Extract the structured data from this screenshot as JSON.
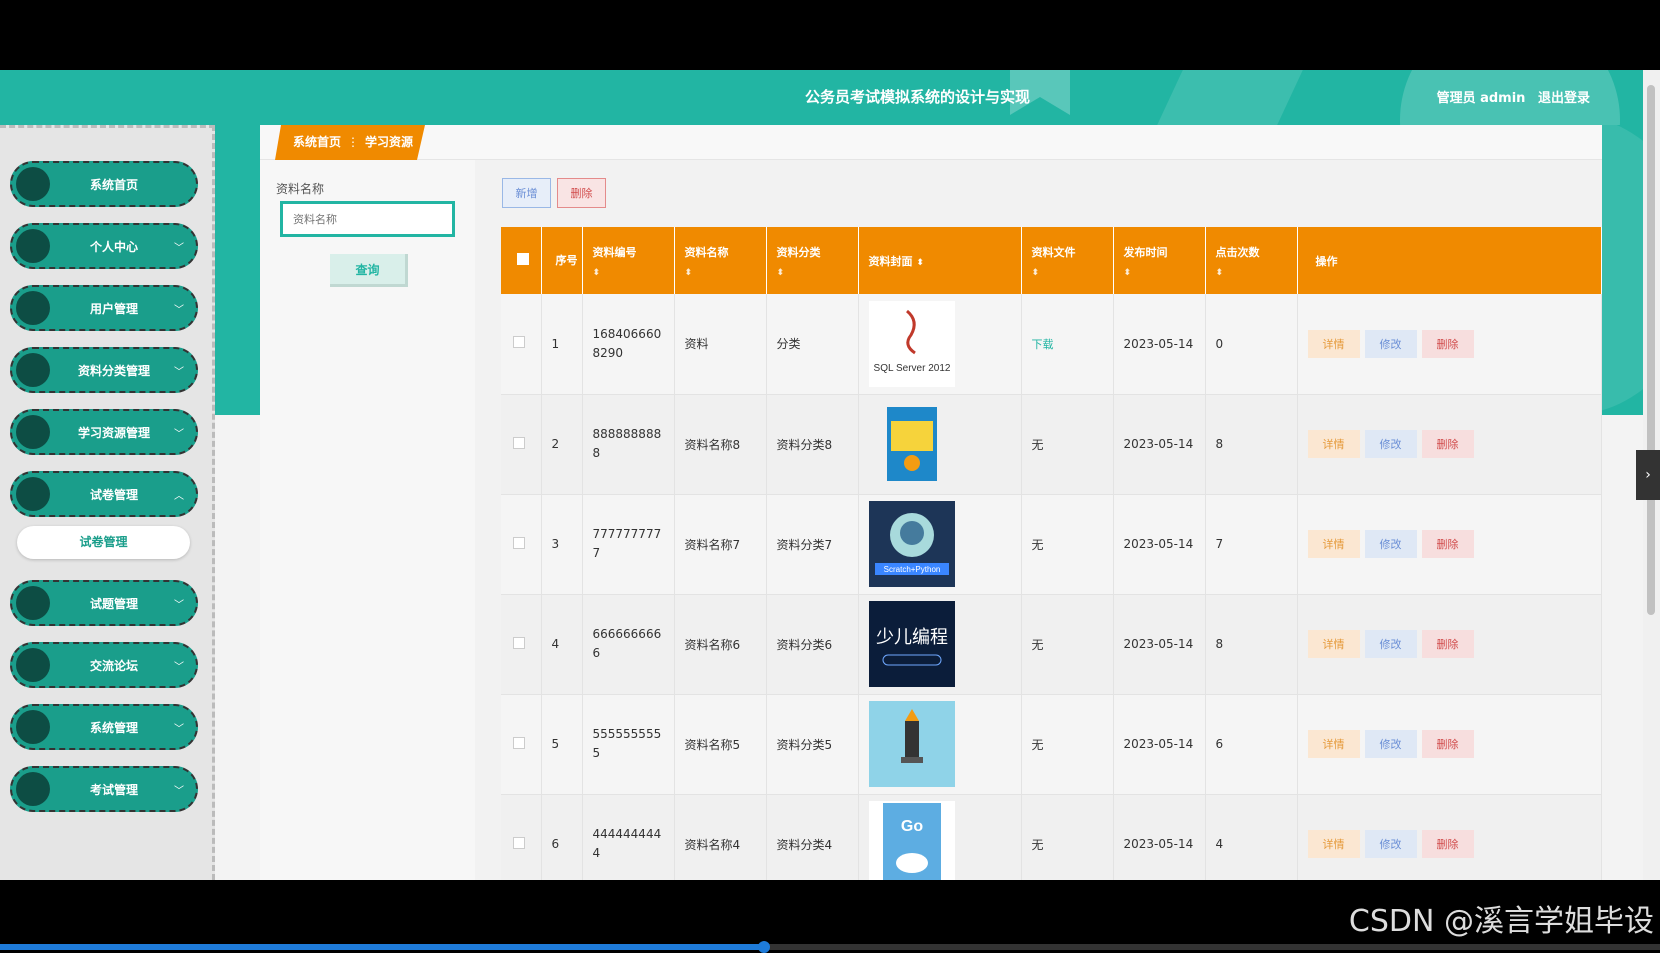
{
  "header": {
    "title": "公务员考试模拟系统的设计与实现",
    "user_role": "管理员 admin",
    "logout": "退出登录"
  },
  "sidebar": {
    "items": [
      {
        "label": "系统首页",
        "chevron": ""
      },
      {
        "label": "个人中心",
        "chevron": "﹀"
      },
      {
        "label": "用户管理",
        "chevron": "﹀"
      },
      {
        "label": "资料分类管理",
        "chevron": "﹀"
      },
      {
        "label": "学习资源管理",
        "chevron": "﹀"
      },
      {
        "label": "试卷管理",
        "chevron": "︿"
      },
      {
        "label": "试题管理",
        "chevron": "﹀"
      },
      {
        "label": "交流论坛",
        "chevron": "﹀"
      },
      {
        "label": "系统管理",
        "chevron": "﹀"
      },
      {
        "label": "考试管理",
        "chevron": "﹀"
      }
    ],
    "sub_item": "试卷管理"
  },
  "breadcrumb": {
    "home": "系统首页",
    "separator": "⋮",
    "current": "学习资源"
  },
  "search": {
    "label": "资料名称",
    "placeholder": "资料名称",
    "button": "查询"
  },
  "toolbar": {
    "add": "新增",
    "delete": "删除"
  },
  "table": {
    "headers": [
      "序号",
      "资料编号",
      "资料名称",
      "资料分类",
      "资料封面",
      "资料文件",
      "发布时间",
      "点击次数",
      "操作"
    ],
    "rows": [
      {
        "index": "1",
        "code": "1684066608290",
        "name": "资料",
        "category": "分类",
        "cover": "sql-server-cover",
        "file": "下载",
        "date": "2023-05-14",
        "clicks": "0"
      },
      {
        "index": "2",
        "code": "8888888888",
        "name": "资料名称8",
        "category": "资料分类8",
        "cover": "book-cover-yellow",
        "file": "无",
        "date": "2023-05-14",
        "clicks": "8"
      },
      {
        "index": "3",
        "code": "7777777777",
        "name": "资料名称7",
        "category": "资料分类7",
        "cover": "scratch-python-cover",
        "file": "无",
        "date": "2023-05-14",
        "clicks": "7"
      },
      {
        "index": "4",
        "code": "6666666666",
        "name": "资料名称6",
        "category": "资料分类6",
        "cover": "kids-programming-cover",
        "file": "无",
        "date": "2023-05-14",
        "clicks": "8"
      },
      {
        "index": "5",
        "code": "5555555555",
        "name": "资料名称5",
        "category": "资料分类5",
        "cover": "lighthouse-cover",
        "file": "无",
        "date": "2023-05-14",
        "clicks": "6"
      },
      {
        "index": "6",
        "code": "4444444444",
        "name": "资料名称4",
        "category": "资料分类4",
        "cover": "go-cover",
        "file": "无",
        "date": "2023-05-14",
        "clicks": "4"
      }
    ],
    "actions": {
      "detail": "详情",
      "edit": "修改",
      "delete": "删除"
    }
  },
  "cover_text": {
    "sql": "SQL Server 2012",
    "scratch": "Scratch+Python",
    "kids": "少儿编程",
    "go": "Go"
  },
  "watermark": "CSDN @溪言学姐毕设",
  "video_progress": 0.46,
  "colors": {
    "teal": "#22b5a3",
    "orange": "#f08a00"
  }
}
